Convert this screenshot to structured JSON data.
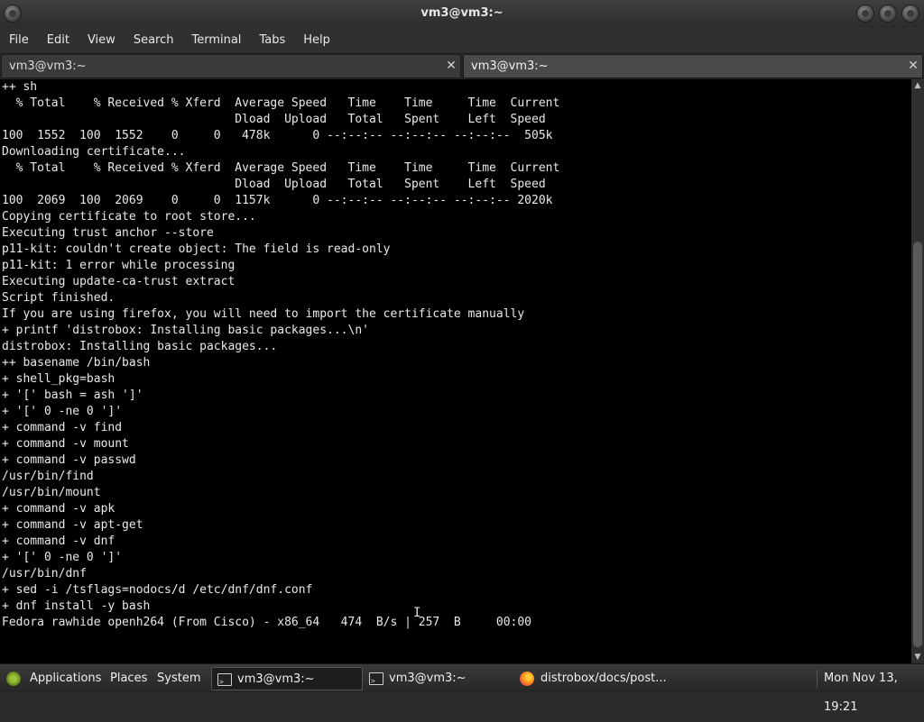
{
  "window": {
    "title": "vm3@vm3:~"
  },
  "menu": [
    "File",
    "Edit",
    "View",
    "Search",
    "Terminal",
    "Tabs",
    "Help"
  ],
  "tabs": [
    {
      "label": "vm3@vm3:~",
      "active": false
    },
    {
      "label": "vm3@vm3:~",
      "active": true
    }
  ],
  "terminal": {
    "lines": [
      "++ sh",
      "  % Total    % Received % Xferd  Average Speed   Time    Time     Time  Current",
      "                                 Dload  Upload   Total   Spent    Left  Speed",
      "100  1552  100  1552    0     0   478k      0 --:--:-- --:--:-- --:--:--  505k",
      "Downloading certificate...",
      "  % Total    % Received % Xferd  Average Speed   Time    Time     Time  Current",
      "                                 Dload  Upload   Total   Spent    Left  Speed",
      "100  2069  100  2069    0     0  1157k      0 --:--:-- --:--:-- --:--:-- 2020k",
      "Copying certificate to root store...",
      "Executing trust anchor --store",
      "p11-kit: couldn't create object: The field is read-only",
      "p11-kit: 1 error while processing",
      "Executing update-ca-trust extract",
      "Script finished.",
      "If you are using firefox, you will need to import the certificate manually",
      "+ printf 'distrobox: Installing basic packages...\\n'",
      "distrobox: Installing basic packages...",
      "++ basename /bin/bash",
      "+ shell_pkg=bash",
      "+ '[' bash = ash ']'",
      "+ '[' 0 -ne 0 ']'",
      "+ command -v find",
      "+ command -v mount",
      "+ command -v passwd",
      "/usr/bin/find",
      "/usr/bin/mount",
      "+ command -v apk",
      "+ command -v apt-get",
      "+ command -v dnf",
      "+ '[' 0 -ne 0 ']'",
      "/usr/bin/dnf",
      "+ sed -i /tsflags=nodocs/d /etc/dnf/dnf.conf",
      "+ dnf install -y bash",
      "Fedora rawhide openh264 (From Cisco) - x86_64   474  B/s | 257  B     00:00"
    ]
  },
  "panel": {
    "applications": "Applications",
    "places": "Places",
    "system": "System",
    "tasks": [
      {
        "label": "vm3@vm3:~",
        "icon": "terminal-icon",
        "active": true
      },
      {
        "label": "vm3@vm3:~",
        "icon": "terminal-icon",
        "active": false
      },
      {
        "label": "distrobox/docs/post...",
        "icon": "firefox-icon",
        "active": false
      }
    ],
    "clock": "Mon Nov 13, 19:21"
  }
}
